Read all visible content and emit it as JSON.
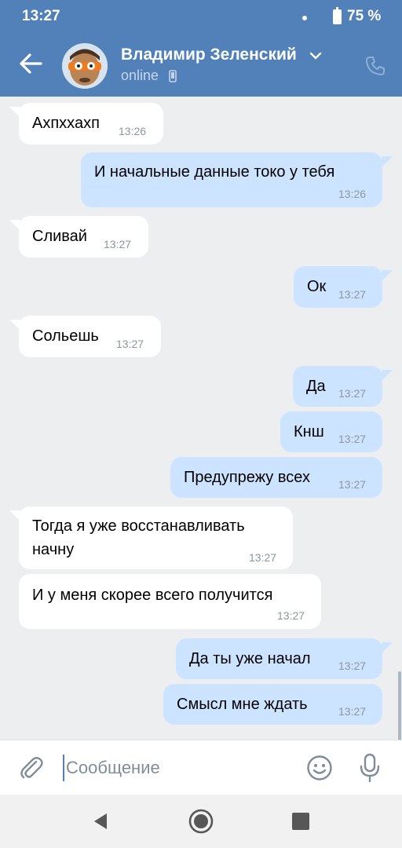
{
  "status_bar": {
    "time": "13:27",
    "battery": "75 %"
  },
  "header": {
    "contact_name": "Владимир Зеленский",
    "presence": "online"
  },
  "messages": [
    {
      "dir": "in",
      "text": "Ахпххахп",
      "time": "13:26"
    },
    {
      "dir": "out",
      "text": "И начальные данные токо у тебя",
      "time": "13:26"
    },
    {
      "dir": "in",
      "text": "Сливай",
      "time": "13:27"
    },
    {
      "dir": "out",
      "text": "Ок",
      "time": "13:27"
    },
    {
      "dir": "in",
      "text": "Сольешь",
      "time": "13:27"
    },
    {
      "dir": "out",
      "text": "Да",
      "time": "13:27"
    },
    {
      "dir": "out",
      "text": "Кнш",
      "time": "13:27"
    },
    {
      "dir": "out",
      "text": "Предупрежу всех",
      "time": "13:27"
    },
    {
      "dir": "in",
      "text_line1": "Тогда я уже восстанавливать",
      "text_line2": "начну",
      "time": "13:27"
    },
    {
      "dir": "in",
      "text": "И у меня скорее всего получится",
      "time": "13:27"
    },
    {
      "dir": "out",
      "text": "Да ты уже начал",
      "time": "13:27"
    },
    {
      "dir": "out",
      "text": "Смысл мне ждать",
      "time": "13:27"
    }
  ],
  "composer": {
    "placeholder": "Сообщение"
  },
  "icons": {
    "back": "arrow-left-icon",
    "dropdown": "chevron-down-icon",
    "mobile": "mobile-phone-icon",
    "call": "phone-icon",
    "attach": "paperclip-icon",
    "emoji": "smile-icon",
    "voice": "microphone-icon"
  },
  "colors": {
    "header": "#5181b8",
    "incoming_bubble": "#ffffff",
    "outgoing_bubble": "#cce4ff",
    "chat_background": "#edeef0"
  }
}
